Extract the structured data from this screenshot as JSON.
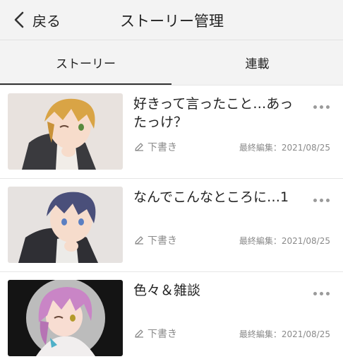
{
  "header": {
    "back_label": "戻る",
    "title": "ストーリー管理"
  },
  "tabs": [
    {
      "label": "ストーリー",
      "active": true
    },
    {
      "label": "連載",
      "active": false
    }
  ],
  "stories": [
    {
      "title": "好きって言ったこと…あったっけ？",
      "status": "下書き",
      "edited": "最終編集：2021/08/25",
      "thumb_icon": "anime-boy-blonde-thumbnail"
    },
    {
      "title": "なんでこんなところに…1",
      "status": "下書き",
      "edited": "最終編集：2021/08/25",
      "thumb_icon": "anime-boy-navy-thumbnail"
    },
    {
      "title": "色々＆雑談",
      "status": "下書き",
      "edited": "最終編集：2021/08/25",
      "thumb_icon": "anime-character-pink-hair-thumbnail"
    }
  ],
  "colors": {
    "header_bg": "#f3f3f3",
    "text": "#222222",
    "subtext": "#8a8a8a",
    "divider": "#e6e6e6"
  }
}
